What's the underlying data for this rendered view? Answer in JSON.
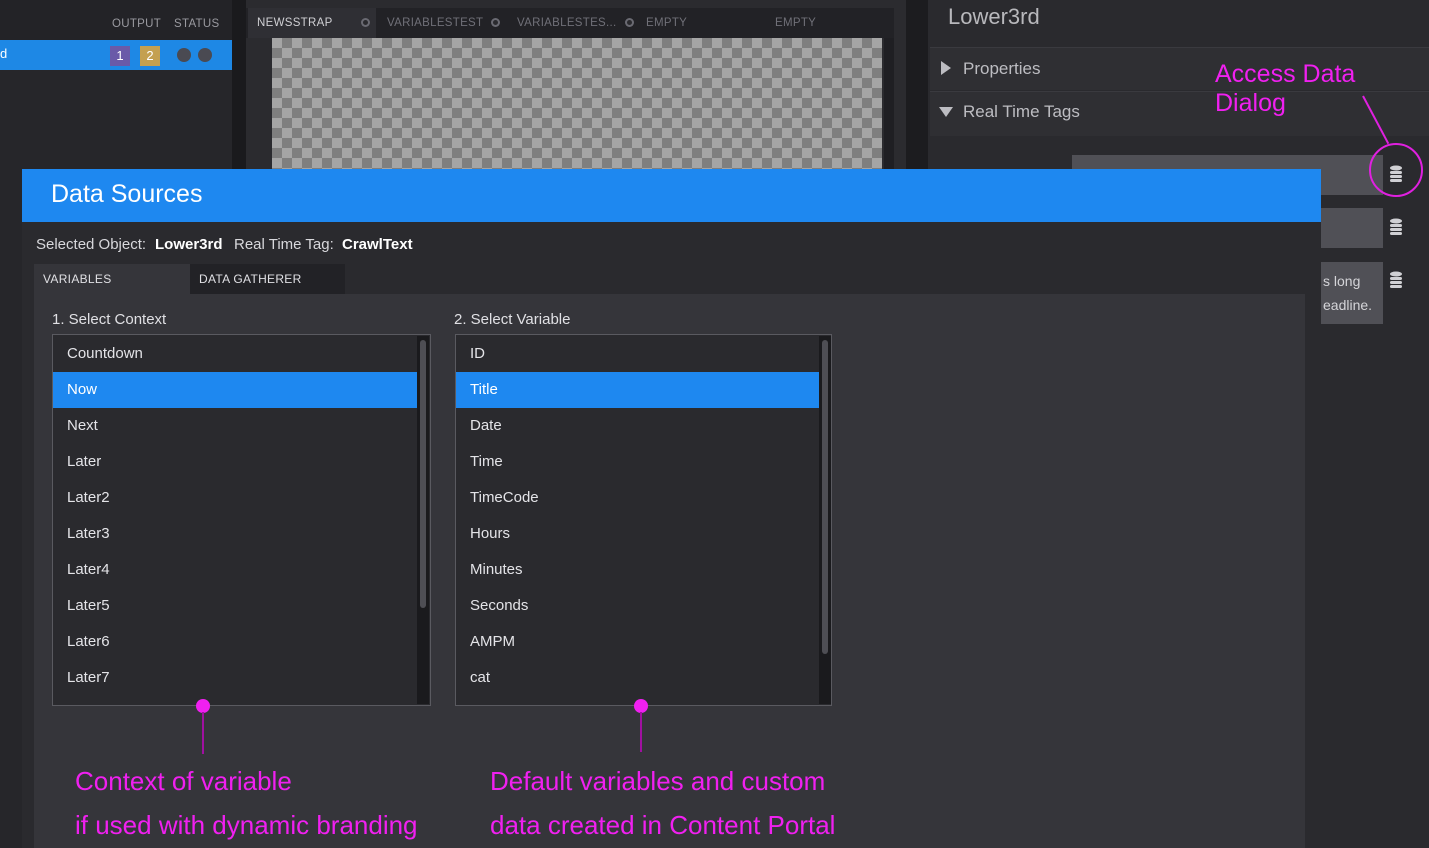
{
  "left_panel": {
    "col_output": "OUTPUT",
    "col_status": "STATUS",
    "row_text": "d",
    "badge_1": "1",
    "badge_2": "2"
  },
  "preview_tabs": [
    {
      "label": "NEWSSTRAP",
      "active": true,
      "closable": true
    },
    {
      "label": "VARIABLESTEST",
      "active": false,
      "closable": true
    },
    {
      "label": "VARIABLESTES...",
      "active": false,
      "closable": true
    },
    {
      "label": "EMPTY",
      "active": false,
      "closable": false
    },
    {
      "label": "EMPTY",
      "active": false,
      "closable": false
    }
  ],
  "properties_panel": {
    "title": "Lower3rd",
    "section_properties": "Properties",
    "section_realtime": "Real Time Tags",
    "field3_line1": "s long",
    "field3_line2": "eadline."
  },
  "annotations": {
    "access": "Access Data Dialog",
    "context_line1": "Context of variable",
    "context_line2": "if used with dynamic branding",
    "variables_line1": "Default variables and custom",
    "variables_line2": "data created in Content Portal"
  },
  "dialog": {
    "title": "Data Sources",
    "selected_object_label": "Selected Object:",
    "selected_object_value": "Lower3rd",
    "realtime_tag_label": "Real Time Tag:",
    "realtime_tag_value": "CrawlText",
    "tabs": [
      "VARIABLES",
      "DATA GATHERER"
    ],
    "context_label": "1. Select Context",
    "variable_label": "2. Select Variable",
    "contexts": [
      "Countdown",
      "Now",
      "Next",
      "Later",
      "Later2",
      "Later3",
      "Later4",
      "Later5",
      "Later6",
      "Later7"
    ],
    "selected_context": "Now",
    "variables": [
      "ID",
      "Title",
      "Date",
      "Time",
      "TimeCode",
      "Hours",
      "Minutes",
      "Seconds",
      "AMPM",
      "cat"
    ],
    "selected_variable": "Title"
  },
  "colors": {
    "accent": "#1e88f0",
    "annotation": "#f020f0"
  }
}
